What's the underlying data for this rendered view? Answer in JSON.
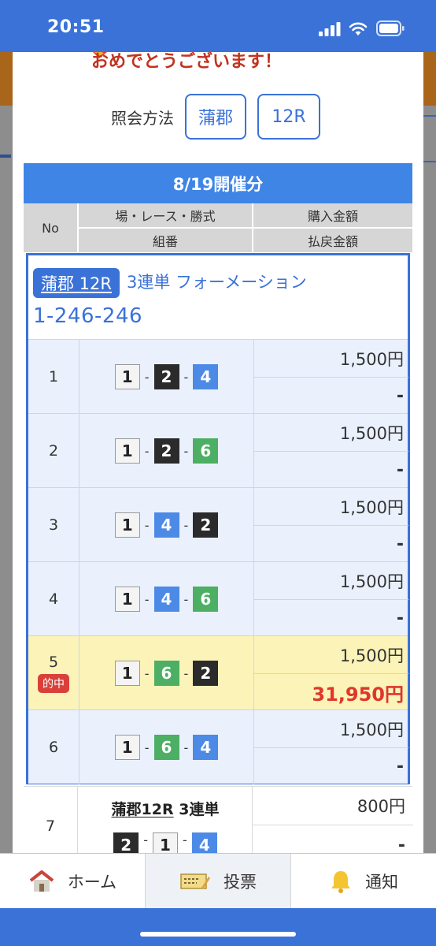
{
  "status_bar": {
    "time": "20:51"
  },
  "modal": {
    "congrats_text": "おめでとうございます！",
    "inquiry": {
      "label": "照会方法",
      "venue_button": "蒲郡",
      "race_button": "12R"
    },
    "date_header": "8/19開催分",
    "table_header": {
      "no": "No",
      "race_info": "場・レース・勝式",
      "purchase_amount": "購入金額",
      "combination": "組番",
      "payout_amount": "払戻金額"
    },
    "group": {
      "badge": "蒲郡 12R",
      "bet_type": "3連単 フォーメーション",
      "combination": "1-246-246",
      "rows": [
        {
          "no": "1",
          "boats": [
            "1",
            "2",
            "4"
          ],
          "purchase": "1,500円",
          "payout": "-",
          "hit": false
        },
        {
          "no": "2",
          "boats": [
            "1",
            "2",
            "6"
          ],
          "purchase": "1,500円",
          "payout": "-",
          "hit": false
        },
        {
          "no": "3",
          "boats": [
            "1",
            "4",
            "2"
          ],
          "purchase": "1,500円",
          "payout": "-",
          "hit": false
        },
        {
          "no": "4",
          "boats": [
            "1",
            "4",
            "6"
          ],
          "purchase": "1,500円",
          "payout": "-",
          "hit": false
        },
        {
          "no": "5",
          "boats": [
            "1",
            "6",
            "2"
          ],
          "purchase": "1,500円",
          "payout": "31,950円",
          "hit": true,
          "hit_label": "的中"
        },
        {
          "no": "6",
          "boats": [
            "1",
            "6",
            "4"
          ],
          "purchase": "1,500円",
          "payout": "-",
          "hit": false
        }
      ]
    },
    "row7": {
      "no": "7",
      "race": "蒲郡12R",
      "bet_type": "3連単",
      "boats": [
        "2",
        "1",
        "4"
      ],
      "purchase": "800円",
      "payout": "-"
    }
  },
  "boat_colors": {
    "1": "#f4f4f4",
    "2": "#2b2b2b",
    "4": "#4c8ae6",
    "6": "#4caf63"
  },
  "accent_color": "#3a72d8",
  "win_color": "#e0362b",
  "tabbar": {
    "items": [
      {
        "label": "ホーム",
        "icon": "house-icon"
      },
      {
        "label": "投票",
        "icon": "ticket-icon",
        "active": true
      },
      {
        "label": "通知",
        "icon": "bell-icon"
      }
    ]
  }
}
